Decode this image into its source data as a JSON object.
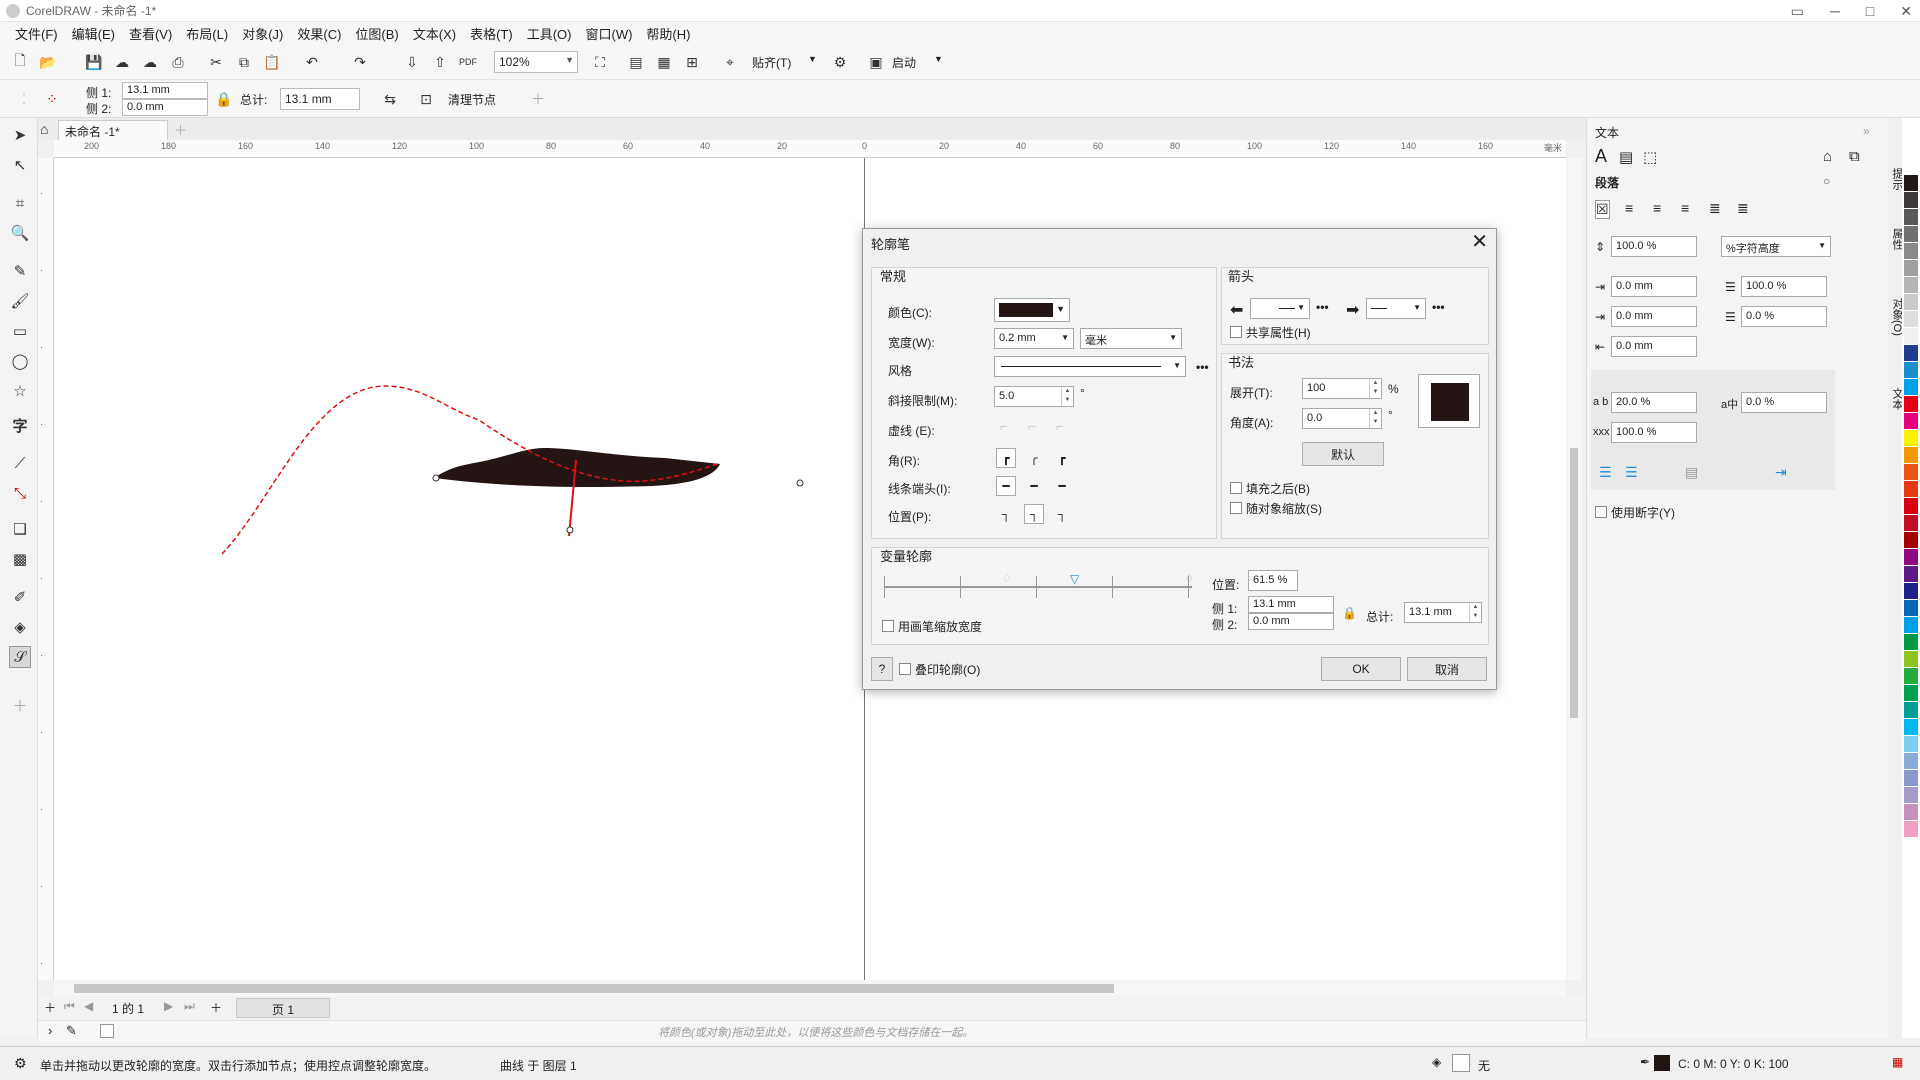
{
  "window": {
    "title": "CorelDRAW - 未命名 -1*"
  },
  "menu": [
    "文件(F)",
    "编辑(E)",
    "查看(V)",
    "布局(L)",
    "对象(J)",
    "效果(C)",
    "位图(B)",
    "文本(X)",
    "表格(T)",
    "工具(O)",
    "窗口(W)",
    "帮助(H)"
  ],
  "toolbar": {
    "zoom": "102%",
    "snap": "贴齐(T)",
    "launch": "启动"
  },
  "propbar": {
    "side1_label": "侧 1:",
    "side1_value": "13.1 mm",
    "side2_label": "侧 2:",
    "side2_value": "0.0 mm",
    "total_label": "总计:",
    "total_value": "13.1 mm",
    "clean_nodes": "清理节点"
  },
  "document": {
    "tab": "未命名 -1*"
  },
  "ruler": {
    "h_ticks": [
      "200",
      "180",
      "160",
      "140",
      "120",
      "100",
      "80",
      "60",
      "40",
      "20",
      "0",
      "20",
      "40",
      "60",
      "80",
      "100",
      "120",
      "140",
      "160"
    ],
    "unit": "毫米"
  },
  "page_nav": {
    "counter": "1 的 1",
    "page_tab": "页 1"
  },
  "color_tray": {
    "hint": "将颜色(或对象)拖动至此处，以便将这些颜色与文档存储在一起。"
  },
  "status": {
    "hint": "单击并拖动以更改轮廓的宽度。双击行添加节点；使用控点调整轮廓宽度。",
    "object": "曲线 于 图层 1",
    "fill": "无",
    "outline": "C: 0 M: 0 Y: 0 K: 100"
  },
  "dialog": {
    "title": "轮廓笔",
    "general": {
      "title": "常规",
      "color_label": "颜色(C):",
      "width_label": "宽度(W):",
      "width_value": "0.2 mm",
      "unit": "毫米",
      "style_label": "风格",
      "miter_label": "斜接限制(M):",
      "miter_value": "5.0",
      "miter_unit": "°",
      "dash_label": "虚线 (E):",
      "corner_label": "角(R):",
      "cap_label": "线条端头(I):",
      "position_label": "位置(P):"
    },
    "arrows": {
      "title": "箭头",
      "share": "共享属性(H)"
    },
    "calligraphy": {
      "title": "书法",
      "stretch_label": "展开(T):",
      "stretch_value": "100",
      "stretch_unit": "%",
      "angle_label": "角度(A):",
      "angle_value": "0.0",
      "angle_unit": "°",
      "default_btn": "默认",
      "fill_behind": "填充之后(B)",
      "scale_with": "随对象缩放(S)"
    },
    "variable": {
      "title": "变量轮廓",
      "position_label": "位置:",
      "position_value": "61.5 %",
      "side1_label": "侧 1:",
      "side1_value": "13.1 mm",
      "side2_label": "侧 2:",
      "side2_value": "0.0 mm",
      "total_label": "总计:",
      "total_value": "13.1 mm",
      "pressure": "用画笔缩放宽度"
    },
    "help": "?",
    "overprint": "叠印轮廓(O)",
    "ok": "OK",
    "cancel": "取消"
  },
  "docker": {
    "title": "文本",
    "section": "段落",
    "v1": "100.0 %",
    "v1_unit": "%字符高度",
    "left_indent": "0.0 mm",
    "line_spacing": "100.0 %",
    "first_indent": "0.0 mm",
    "before": "0.0 %",
    "right_indent": "0.0 mm",
    "char_spacing": "20.0 %",
    "word_spacing": "0.0 %",
    "lang_spacing": "100.0 %",
    "hyphen": "使用断字(Y)",
    "side_tabs": [
      "提示",
      "属性",
      "对象(O)",
      "文本"
    ]
  },
  "colors": {
    "accent": "#1e8fd8",
    "shape_fill": "#241414",
    "path_red": "#e01010",
    "palette": [
      "#ffffff",
      "#231815",
      "#3e3a39",
      "#595757",
      "#727171",
      "#898989",
      "#9fa0a0",
      "#b5b5b6",
      "#c9caca",
      "#dcdddd",
      "#efefef",
      "#1f3d8f",
      "#1a8fd0",
      "#00a0e9",
      "#e60012",
      "#e4007f",
      "#fff100",
      "#f39800",
      "#ea5514",
      "#e8380d",
      "#d7000f",
      "#c30d23",
      "#a40000",
      "#920783",
      "#601986",
      "#1d2088",
      "#0068b7",
      "#00a0e9",
      "#009944",
      "#8fc31f",
      "#22ac38",
      "#00a051",
      "#009e96",
      "#00b7ee",
      "#7ecef4",
      "#88abda",
      "#8c97cb",
      "#a59aca",
      "#c490bf",
      "#f19ec2"
    ]
  }
}
